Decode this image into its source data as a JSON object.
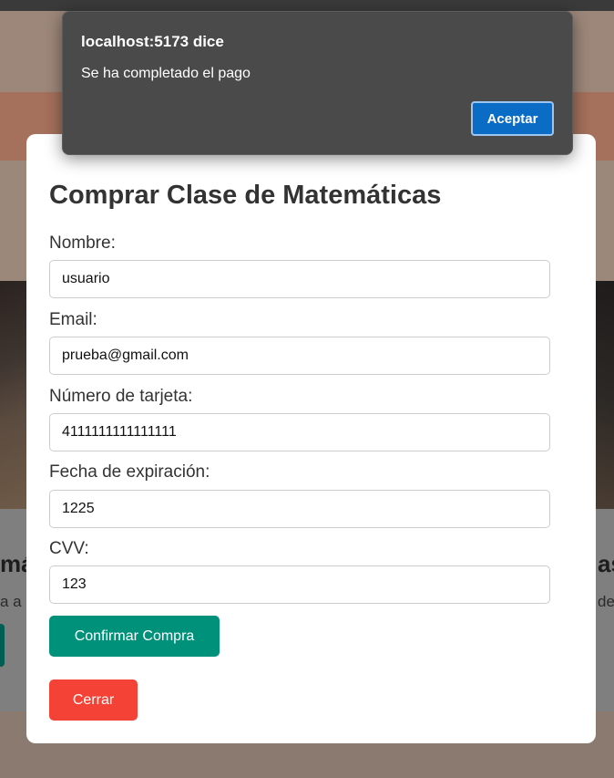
{
  "alert": {
    "title": "localhost:5173 dice",
    "message": "Se ha completado el pago",
    "ok_label": "Aceptar"
  },
  "modal": {
    "title": "Comprar Clase de Matemáticas",
    "fields": {
      "name": {
        "label": "Nombre:",
        "value": "usuario"
      },
      "email": {
        "label": "Email:",
        "value": "prueba@gmail.com"
      },
      "card": {
        "label": "Número de tarjeta:",
        "value": "4111111111111111"
      },
      "expiry": {
        "label": "Fecha de expiración:",
        "value": "1225"
      },
      "cvv": {
        "label": "CVV:",
        "value": "123"
      }
    },
    "confirm_label": "Confirmar Compra",
    "close_label": "Cerrar"
  },
  "background": {
    "card_left_title": "má",
    "card_left_text": "a a",
    "card_right_title": "as",
    "card_right_text": "de"
  },
  "colors": {
    "confirm_button": "#00917a",
    "close_button": "#f44336",
    "alert_button": "#0b6cc5"
  }
}
